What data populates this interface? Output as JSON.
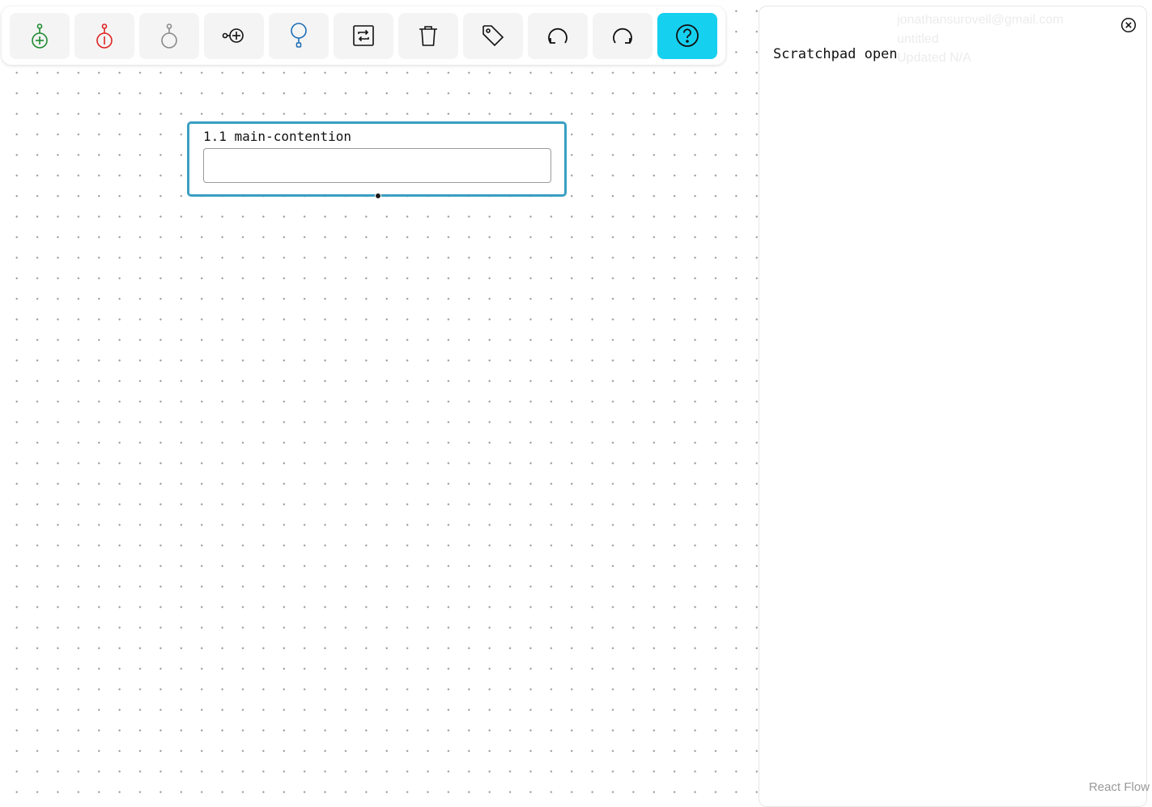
{
  "toolbar": {
    "buttons": [
      {
        "icon": "add-support-node-icon",
        "color": "#1e8a2f"
      },
      {
        "icon": "add-objection-node-icon",
        "color": "#e02424"
      },
      {
        "icon": "add-neutral-node-icon",
        "color": "#8a8a8a"
      },
      {
        "icon": "add-linked-node-icon",
        "color": "#111111"
      },
      {
        "icon": "add-contention-node-icon",
        "color": "#1f6fb5"
      },
      {
        "icon": "swap-icon",
        "color": "#111111"
      },
      {
        "icon": "trash-icon",
        "color": "#111111"
      },
      {
        "icon": "tag-icon",
        "color": "#111111"
      },
      {
        "icon": "undo-icon",
        "color": "#111111"
      },
      {
        "icon": "redo-icon",
        "color": "#111111"
      },
      {
        "icon": "help-icon",
        "color": "#111111",
        "active": true,
        "active_bg": "#16d0f0"
      }
    ]
  },
  "node": {
    "label": "1.1 main-contention",
    "input_value": "",
    "border_color": "#3a9fc2"
  },
  "scratchpad": {
    "user_email": "jonathansurovell@gmail.com",
    "doc_title": "untitled",
    "updated": "Updated N/A",
    "title": "Scratchpad open",
    "close_icon": "close-circle-icon"
  },
  "attribution": "React Flow"
}
